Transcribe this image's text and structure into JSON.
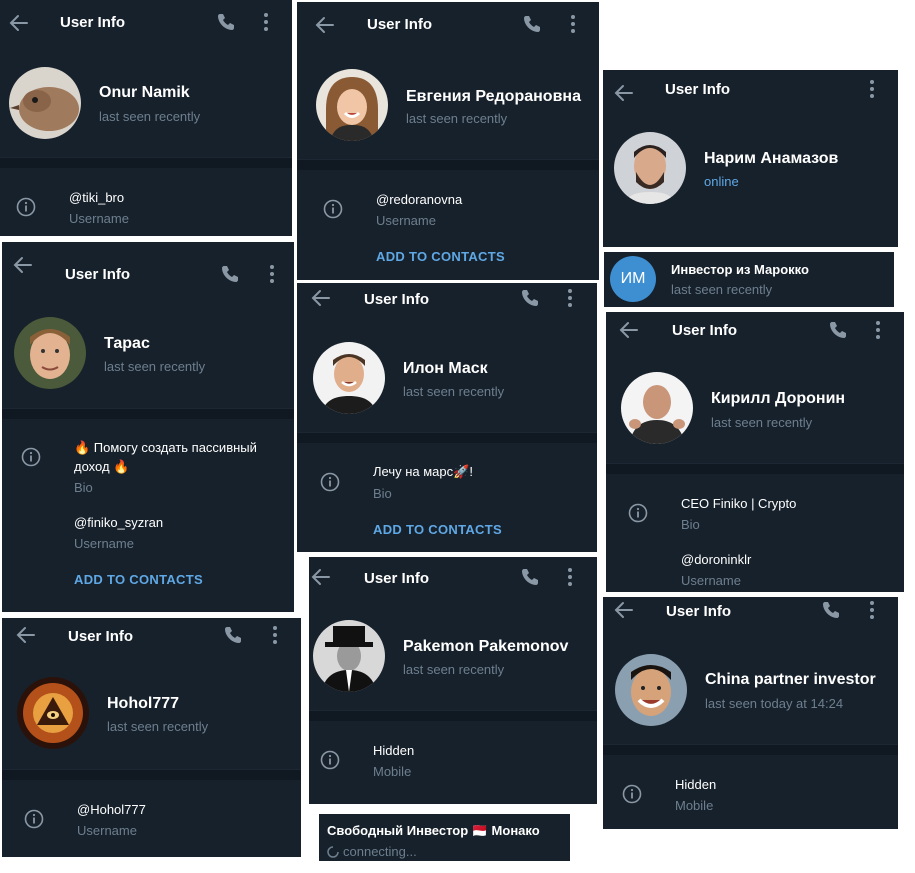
{
  "common": {
    "header_title": "User Info",
    "last_seen": "last seen recently",
    "username_label": "Username",
    "bio_label": "Bio",
    "mobile_label": "Mobile",
    "add_to_contacts": "ADD TO CONTACTS"
  },
  "cards": {
    "onur": {
      "name": "Onur Namik",
      "status": "last seen recently",
      "username": "@tiki_bro"
    },
    "evgenia": {
      "name": "Евгения Редорановна",
      "status": "last seen recently",
      "username": "@redoranovna"
    },
    "narim": {
      "name": "Нарим Анамазов",
      "status": "online"
    },
    "investor_morocco": {
      "initials": "ИМ",
      "name": "Инвестор из Марокко",
      "status": "last seen recently"
    },
    "taras": {
      "name": "Тарас",
      "status": "last seen recently",
      "bio_line1": "🔥 Помогу создать пассивный",
      "bio_line2": "доход 🔥",
      "username": "@finiko_syzran"
    },
    "elon": {
      "name": "Илон Маск",
      "status": "last seen recently",
      "bio": "Лечу на марс🚀!"
    },
    "kirill": {
      "name": "Кирилл Доронин",
      "status": "last seen recently",
      "bio": "CEO Finiko | Crypto",
      "username": "@doroninklr"
    },
    "pakemon": {
      "name": "Pakemon Pakemonov",
      "status": "last seen recently",
      "mobile": "Hidden"
    },
    "hohol": {
      "name": "Hohol777",
      "status": "last seen recently",
      "username": "@Hohol777"
    },
    "china": {
      "name": "China partner investor",
      "status": "last seen today at 14:24",
      "mobile": "Hidden"
    },
    "monaco": {
      "name": "Свободный Инвестор 🇲🇨 Монако",
      "status": "connecting..."
    }
  },
  "colors": {
    "background": "#17212b",
    "separator": "#101921",
    "accent": "#5fa8e6",
    "muted": "#6d7f8f"
  },
  "icons": [
    "back-arrow-icon",
    "phone-icon",
    "more-vertical-icon",
    "info-icon",
    "spinner-icon"
  ]
}
